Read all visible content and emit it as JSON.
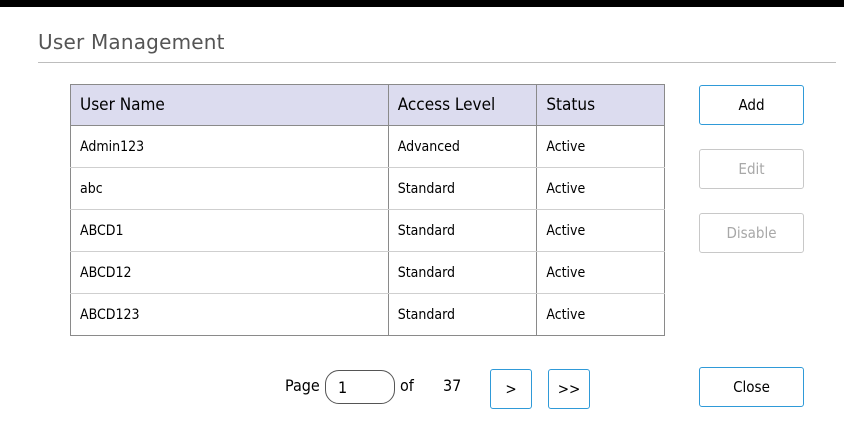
{
  "header": {
    "title": "User Management"
  },
  "table": {
    "columns": [
      "User Name",
      "Access Level",
      "Status"
    ],
    "rows": [
      [
        "Admin123",
        "Advanced",
        "Active"
      ],
      [
        "abc",
        "Standard",
        "Active"
      ],
      [
        "ABCD1",
        "Standard",
        "Active"
      ],
      [
        "ABCD12",
        "Standard",
        "Active"
      ],
      [
        "ABCD123",
        "Standard",
        "Active"
      ]
    ]
  },
  "actions": {
    "add_label": "Add",
    "edit_label": "Edit",
    "disable_label": "Disable",
    "close_label": "Close"
  },
  "pager": {
    "page_label": "Page",
    "current_page": "1",
    "of_label": "of",
    "total_pages": "37",
    "next_label": ">",
    "last_label": ">>"
  },
  "colors": {
    "header_bg": "#dcdcef",
    "accent_border": "#2f9ad8",
    "disabled_text": "#a8a8a8"
  }
}
